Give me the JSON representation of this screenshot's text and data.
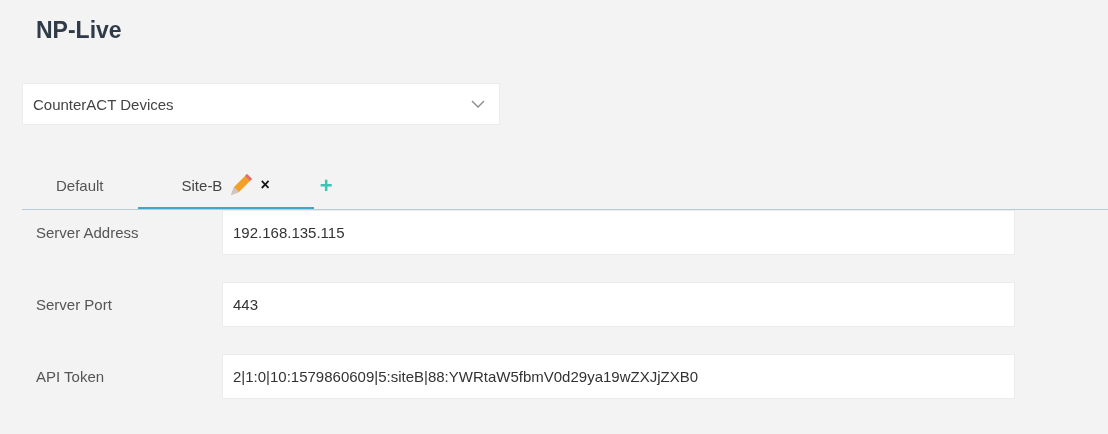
{
  "title": "NP-Live",
  "device_select": {
    "value": "CounterACT Devices"
  },
  "tabs": [
    {
      "label": "Default",
      "selected": false,
      "editable": false
    },
    {
      "label": "Site-B",
      "selected": true,
      "editable": true,
      "close_label": "×"
    }
  ],
  "add_tab": {
    "label": "+"
  },
  "fields": [
    {
      "label": "Server Address",
      "value": "192.168.135.115"
    },
    {
      "label": "Server Port",
      "value": "443"
    },
    {
      "label": "API Token",
      "value": "2|1:0|10:1579860609|5:siteB|88:YWRtaW5fbmV0d29ya19wZXJjZXB0"
    }
  ]
}
